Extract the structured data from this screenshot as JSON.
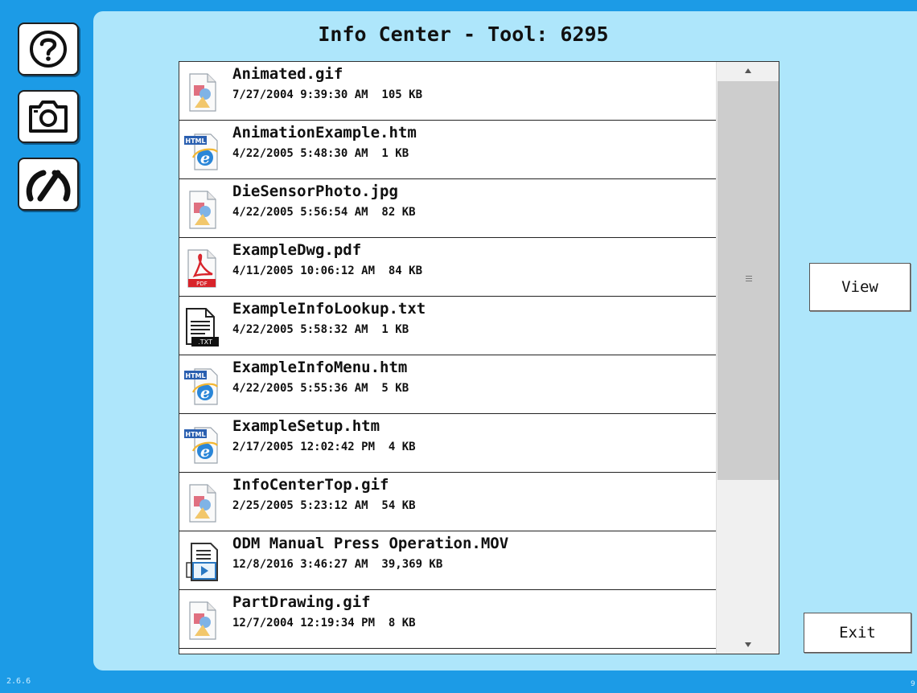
{
  "window": {
    "title": "Info Center - Tool: 6295"
  },
  "sidebar": {
    "help_icon": "question-circle-icon",
    "camera_icon": "camera-icon",
    "gauge_icon": "gauge-icon"
  },
  "files": [
    {
      "name": "Animated.gif",
      "meta": "7/27/2004 9:39:30 AM  105 KB",
      "icon": "image-file-icon"
    },
    {
      "name": "AnimationExample.htm",
      "meta": "4/22/2005 5:48:30 AM  1 KB",
      "icon": "html-file-icon"
    },
    {
      "name": "DieSensorPhoto.jpg",
      "meta": "4/22/2005 5:56:54 AM  82 KB",
      "icon": "image-file-icon"
    },
    {
      "name": "ExampleDwg.pdf",
      "meta": "4/11/2005 10:06:12 AM  84 KB",
      "icon": "pdf-file-icon"
    },
    {
      "name": "ExampleInfoLookup.txt",
      "meta": "4/22/2005 5:58:32 AM  1 KB",
      "icon": "txt-file-icon"
    },
    {
      "name": "ExampleInfoMenu.htm",
      "meta": "4/22/2005 5:55:36 AM  5 KB",
      "icon": "html-file-icon"
    },
    {
      "name": "ExampleSetup.htm",
      "meta": "2/17/2005 12:02:42 PM  4 KB",
      "icon": "html-file-icon"
    },
    {
      "name": "InfoCenterTop.gif",
      "meta": "2/25/2005 5:23:12 AM  54 KB",
      "icon": "image-file-icon"
    },
    {
      "name": "ODM Manual Press Operation.MOV",
      "meta": "12/8/2016 3:46:27 AM  39,369 KB",
      "icon": "video-file-icon"
    },
    {
      "name": "PartDrawing.gif",
      "meta": "12/7/2004 12:19:34 PM  8 KB",
      "icon": "image-file-icon"
    },
    {
      "name": "",
      "meta": "",
      "icon": ""
    }
  ],
  "buttons": {
    "view_label": "View",
    "exit_label": "Exit"
  },
  "footer": {
    "version": "2.6.6",
    "corner": "9"
  },
  "colors": {
    "background": "#1c9be6",
    "panel": "#aee6fb"
  }
}
